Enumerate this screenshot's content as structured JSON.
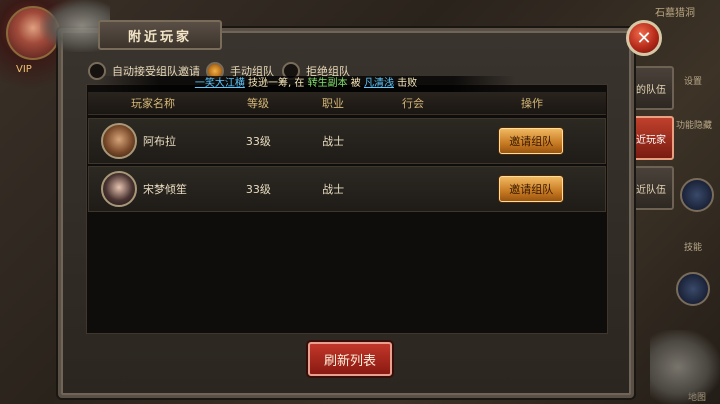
{
  "window": {
    "title": "附近玩家",
    "close_symbol": "✕"
  },
  "background": {
    "top_right_text": "石墓猎洞",
    "vip_label": "VIP"
  },
  "options": {
    "auto_accept_label": "自动接受组队邀请",
    "manual_label": "手动组队",
    "refuse_label": "拒绝组队"
  },
  "broadcast": {
    "player": "一笑大江横",
    "text1": "技逊一筹, 在",
    "place": "转生副本",
    "text2": "被",
    "killer": "凡清浅",
    "text3": "击败"
  },
  "table": {
    "headers": {
      "name": "玩家名称",
      "level": "等级",
      "job": "职业",
      "guild": "行会",
      "op": "操作"
    },
    "rows": [
      {
        "name": "阿布拉",
        "level": "33级",
        "job": "战士",
        "guild": "",
        "button": "邀请组队"
      },
      {
        "name": "宋梦倾笙",
        "level": "33级",
        "job": "战士",
        "guild": "",
        "button": "邀请组队"
      }
    ]
  },
  "refresh_button": "刷新列表",
  "side_tabs": [
    {
      "label": "我的队伍"
    },
    {
      "label": "附近玩家"
    },
    {
      "label": "附近队伍"
    }
  ],
  "side_labels": {
    "settings": "设置",
    "hidden": "功能隐藏",
    "skill": "技能",
    "map": "地图"
  },
  "colors": {
    "accent": "#c0402c",
    "button_gold": "#e0a040"
  }
}
